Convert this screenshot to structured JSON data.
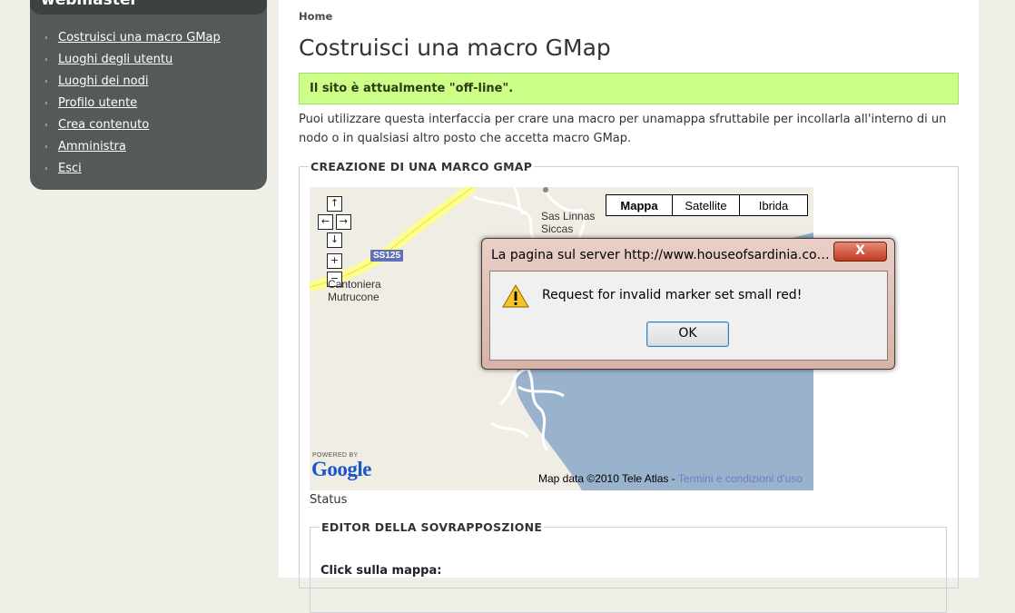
{
  "sidebar": {
    "title": "webmaster",
    "items": [
      {
        "label": "Costruisci una macro GMap"
      },
      {
        "label": "Luoghi degli utentu"
      },
      {
        "label": "Luoghi dei nodi"
      },
      {
        "label": "Profilo utente"
      },
      {
        "label": "Crea contenuto"
      },
      {
        "label": "Amministra"
      },
      {
        "label": "Esci"
      }
    ]
  },
  "breadcrumb": "Home",
  "page_title": "Costruisci una macro GMap",
  "offline_message": "Il sito è attualmente \"off-line\".",
  "intro": "Puoi utilizzare questa interfaccia per crare una macro per unamappa sfruttabile per incollarla all'interno di un nodo o in qualsiasi altro posto che accetta macro GMap.",
  "fieldset_main": {
    "legend": "CREAZIONE DI UNA MARCO GMAP"
  },
  "map": {
    "nav_buttons": {
      "up": "↑",
      "left": "←",
      "right": "→",
      "down": "↓",
      "zoom_in": "+",
      "zoom_out": "−"
    },
    "map_types": [
      "Mappa",
      "Satellite",
      "Ibrida"
    ],
    "selected_map_type": "Mappa",
    "labels": {
      "place1_line1": "Sas Linnas",
      "place1_line2": "Siccas",
      "place2_line1": "Cantoniera",
      "place2_line2": "Mutrucone",
      "road": "SS125"
    },
    "powered_by": "POWERED BY",
    "google_logo": "Google",
    "copyright": "Map data ©2010 Tele Atlas - ",
    "terms_link": "Termini e condizioni d'uso",
    "colors": {
      "land": "#f0ede5",
      "water": "#99b3cc",
      "road": "#ffff88"
    }
  },
  "status": "Status",
  "fieldset_editor": {
    "legend": "EDITOR DELLA SOVRAPPOSZIONE"
  },
  "click_label": "Click sulla mappa:",
  "dialog": {
    "title": "La pagina sul server http://www.houseofsardinia.com rip...",
    "close_glyph": "X",
    "icon": "warning-icon",
    "message": "Request for invalid marker set small red!",
    "ok_label": "OK"
  }
}
